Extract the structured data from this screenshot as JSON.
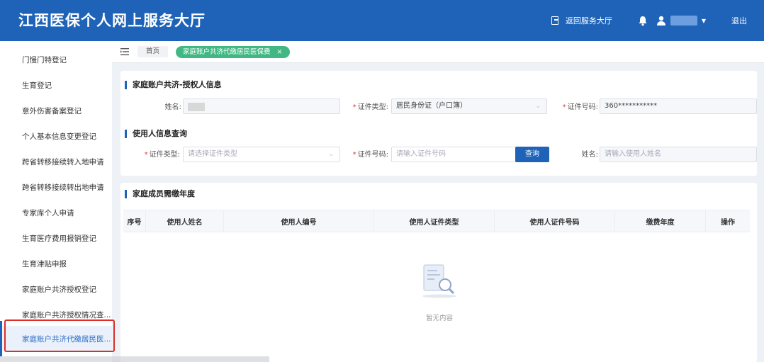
{
  "header": {
    "title": "江西医保个人网上服务大厅",
    "back_link": "返回服务大厅",
    "logout": "退出"
  },
  "sidebar": {
    "items": [
      {
        "label": "门慢门特登记"
      },
      {
        "label": "生育登记"
      },
      {
        "label": "意外伤害备案登记"
      },
      {
        "label": "个人基本信息变更登记"
      },
      {
        "label": "跨省转移接续转入地申请"
      },
      {
        "label": "跨省转移接续转出地申请"
      },
      {
        "label": "专家库个人申请"
      },
      {
        "label": "生育医疗费用报销登记"
      },
      {
        "label": "生育津贴申报"
      },
      {
        "label": "家庭账户共济授权登记"
      },
      {
        "label": "家庭账户共济授权情况查..."
      },
      {
        "label": "家庭账户共济代缴居民医..."
      }
    ],
    "active_index": 11
  },
  "tabs": {
    "home": "首页",
    "active": "家庭账户共济代缴居民医保费",
    "close": "×"
  },
  "authorizer": {
    "section_title": "家庭账户共济-授权人信息",
    "name_label": "姓名:",
    "id_type_label": "证件类型:",
    "id_type_value": "居民身份证（户口簿）",
    "id_no_label": "证件号码:",
    "id_no_value": "360***********"
  },
  "query": {
    "section_title": "使用人信息查询",
    "id_type_label": "证件类型:",
    "id_type_placeholder": "请选择证件类型",
    "id_no_label": "证件号码:",
    "id_no_placeholder": "请输入证件号码",
    "query_button": "查询",
    "name_label": "姓名:",
    "name_placeholder": "请输入使用人姓名"
  },
  "members": {
    "section_title": "家庭成员需缴年度",
    "columns": [
      "序号",
      "使用人姓名",
      "使用人编号",
      "使用人证件类型",
      "使用人证件号码",
      "缴费年度",
      "操作"
    ],
    "rows": [],
    "empty_text": "暂无内容"
  },
  "colors": {
    "header_bg": "#1e63b8",
    "active_tab": "#41b883",
    "highlight_border": "#d9302a"
  }
}
